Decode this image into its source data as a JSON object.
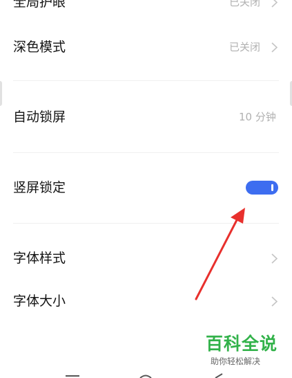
{
  "settings": {
    "items": [
      {
        "label": "全局护眼",
        "value": "已关闭"
      },
      {
        "label": "深色模式",
        "value": "已关闭"
      },
      {
        "label": "自动锁屏",
        "value": "10 分钟"
      },
      {
        "label": "竖屏锁定",
        "toggle_on": true
      },
      {
        "label": "字体样式"
      },
      {
        "label": "字体大小"
      }
    ]
  },
  "watermark": {
    "title": "百科全说",
    "subtitle": "助你轻松解决"
  },
  "colors": {
    "toggle_on": "#3d6df0",
    "annotation_arrow": "#e8302d",
    "watermark_green": "#32b24a"
  },
  "icons": [
    "chevron-right-icon",
    "annotation-arrow",
    "nav-home-icon",
    "nav-back-icon"
  ]
}
